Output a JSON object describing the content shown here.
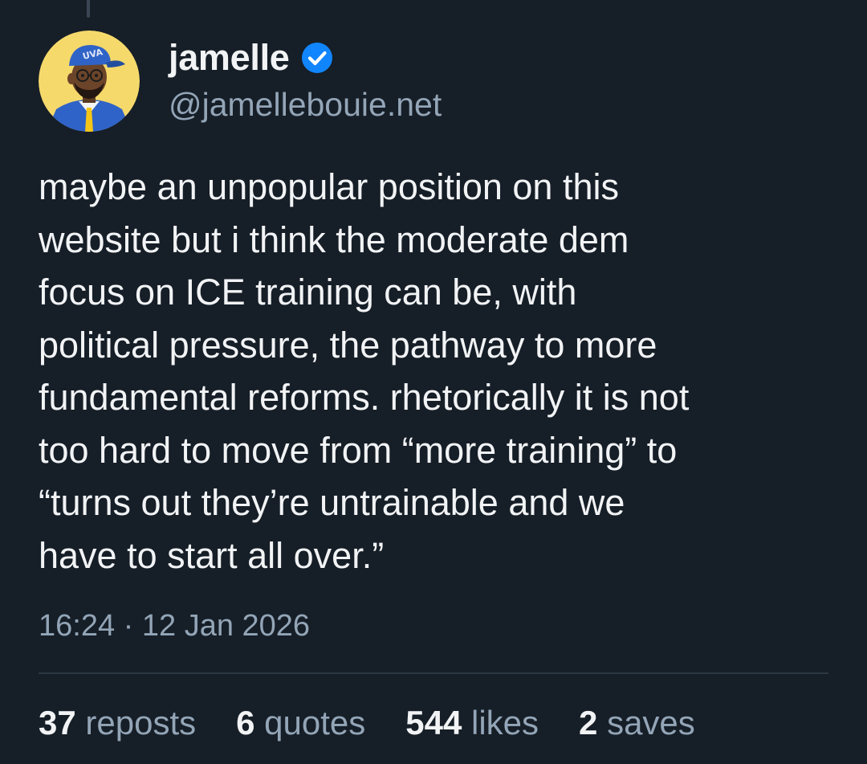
{
  "post": {
    "author": {
      "display_name": "jamelle",
      "handle": "@jamellebouie.net",
      "verified": true,
      "avatar_cap_text": "UVA"
    },
    "text": "maybe an unpopular position on this\nwebsite but i think the moderate dem\nfocus on ICE training can be, with\npolitical pressure, the pathway to more\nfundamental reforms. rhetorically it is not\ntoo hard to move from “more training” to\n“turns out they’re untrainable and we\nhave to start all over.”",
    "timestamp": "16:24 · 12 Jan 2026",
    "stats": {
      "reposts_count": "37",
      "reposts_label": "reposts",
      "quotes_count": "6",
      "quotes_label": "quotes",
      "likes_count": "544",
      "likes_label": "likes",
      "saves_count": "2",
      "saves_label": "saves"
    }
  },
  "colors": {
    "background": "#161e27",
    "text_primary": "#f1f3f5",
    "text_secondary": "#93a5b7",
    "divider": "#2b3744",
    "verified_badge": "#1185fe",
    "avatar_background": "#f5d96b"
  }
}
